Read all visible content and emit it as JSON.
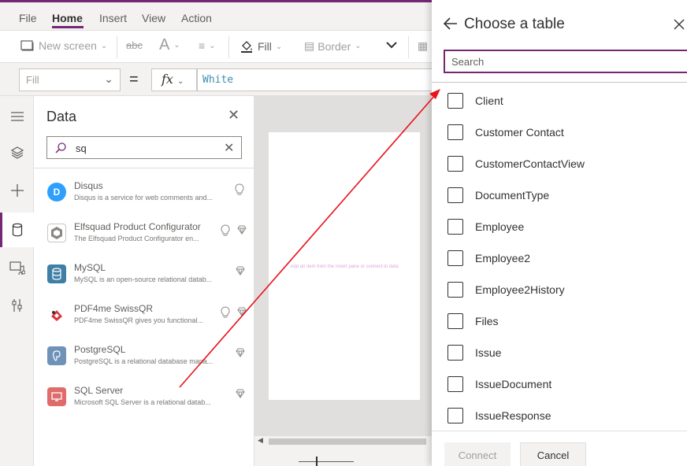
{
  "menu": {
    "items": [
      "File",
      "Home",
      "Insert",
      "View",
      "Action"
    ],
    "active": "Home"
  },
  "ribbon": {
    "new_screen": "New screen",
    "fill": "Fill",
    "border": "Border"
  },
  "formula": {
    "property": "Fill",
    "equals": "=",
    "fx": "fx",
    "value": "White"
  },
  "rail": {
    "icons": [
      "hamburger-icon",
      "layers-icon",
      "plus-icon",
      "database-icon",
      "media-icon",
      "tools-icon"
    ],
    "active": "database-icon"
  },
  "data_panel": {
    "title": "Data",
    "search_value": "sq",
    "connectors": [
      {
        "name": "Disqus",
        "desc": "Disqus is a service for web comments and...",
        "icon": "disqus-logo",
        "color": "#2e9fff",
        "badge": "bulb"
      },
      {
        "name": "Elfsquad Product Configurator",
        "desc": "The Elfsquad Product Configurator en...",
        "icon": "elfsquad-logo",
        "color": "#6b6b6b",
        "badge": "bulb-gem"
      },
      {
        "name": "MySQL",
        "desc": "MySQL is an open-source relational datab...",
        "icon": "mysql-logo",
        "color": "#3f7fa6",
        "badge": "gem"
      },
      {
        "name": "PDF4me SwissQR",
        "desc": "PDF4me SwissQR gives you functional...",
        "icon": "pdf4me-logo",
        "color": "#d9363e",
        "badge": "bulb-gem"
      },
      {
        "name": "PostgreSQL",
        "desc": "PostgreSQL is a relational database mana...",
        "icon": "postgresql-logo",
        "color": "#6f93b8",
        "badge": "gem"
      },
      {
        "name": "SQL Server",
        "desc": "Microsoft SQL Server is a relational datab...",
        "icon": "sqlserver-logo",
        "color": "#e06b6b",
        "badge": "gem"
      }
    ]
  },
  "canvas": {
    "hint": "Add an item from the Insert pane or connect to data"
  },
  "table_panel": {
    "title": "Choose a table",
    "search_placeholder": "Search",
    "tables": [
      "Client",
      "Customer Contact",
      "CustomerContactView",
      "DocumentType",
      "Employee",
      "Employee2",
      "Employee2History",
      "Files",
      "Issue",
      "IssueDocument",
      "IssueResponse"
    ],
    "connect_label": "Connect",
    "cancel_label": "Cancel"
  },
  "colors": {
    "accent": "#742774",
    "annotation_arrow": "#e8131c"
  }
}
